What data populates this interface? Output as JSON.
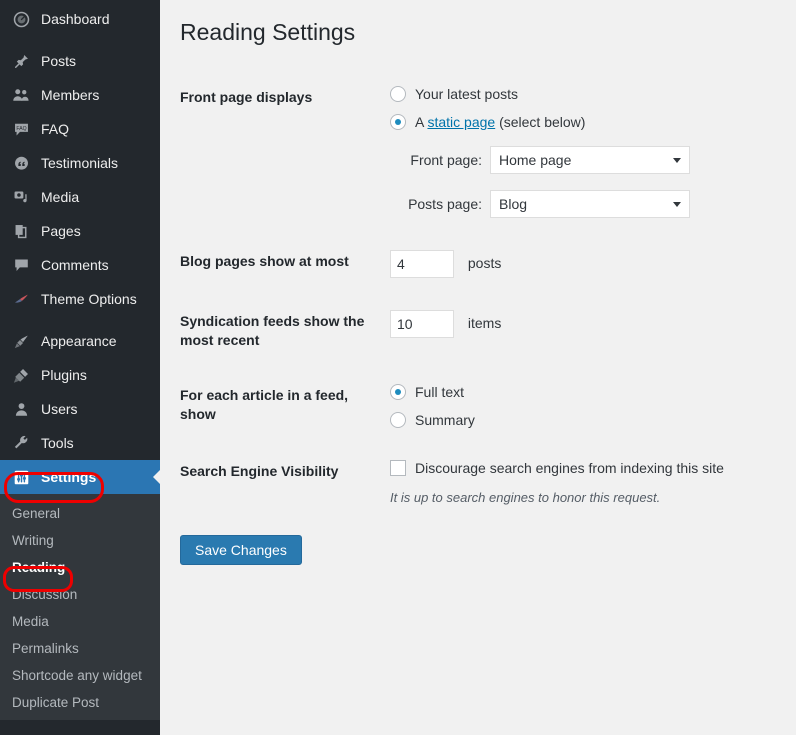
{
  "sidebar": {
    "items": [
      {
        "label": "Dashboard",
        "icon": "dashboard-icon",
        "current": false,
        "gap_after": true
      },
      {
        "label": "Posts",
        "icon": "pin-icon",
        "current": false,
        "gap_after": false
      },
      {
        "label": "Members",
        "icon": "users-group-icon",
        "current": false,
        "gap_after": false
      },
      {
        "label": "FAQ",
        "icon": "faq-bubble-icon",
        "current": false,
        "gap_after": false
      },
      {
        "label": "Testimonials",
        "icon": "quote-bubble-icon",
        "current": false,
        "gap_after": false
      },
      {
        "label": "Media",
        "icon": "media-camera-icon",
        "current": false,
        "gap_after": false
      },
      {
        "label": "Pages",
        "icon": "pages-icon",
        "current": false,
        "gap_after": false
      },
      {
        "label": "Comments",
        "icon": "comment-bubble-icon",
        "current": false,
        "gap_after": false
      },
      {
        "label": "Theme Options",
        "icon": "brush-icon",
        "current": false,
        "gap_after": true
      },
      {
        "label": "Appearance",
        "icon": "paintbrush-icon",
        "current": false,
        "gap_after": false
      },
      {
        "label": "Plugins",
        "icon": "plug-icon",
        "current": false,
        "gap_after": false
      },
      {
        "label": "Users",
        "icon": "user-icon",
        "current": false,
        "gap_after": false
      },
      {
        "label": "Tools",
        "icon": "wrench-icon",
        "current": false,
        "gap_after": false
      },
      {
        "label": "Settings",
        "icon": "settings-sliders-icon",
        "current": true,
        "gap_after": false
      }
    ],
    "submenu": [
      {
        "label": "General",
        "current": false
      },
      {
        "label": "Writing",
        "current": false
      },
      {
        "label": "Reading",
        "current": true
      },
      {
        "label": "Discussion",
        "current": false
      },
      {
        "label": "Media",
        "current": false
      },
      {
        "label": "Permalinks",
        "current": false
      },
      {
        "label": "Shortcode any widget",
        "current": false
      },
      {
        "label": "Duplicate Post",
        "current": false
      }
    ],
    "colors": {
      "background": "#23282d",
      "submenu_background": "#32373c",
      "current_background": "#2b76b3",
      "annotation": "#ee0000"
    }
  },
  "page": {
    "title": "Reading Settings"
  },
  "front_page_displays": {
    "label": "Front page displays",
    "option_latest": "Your latest posts",
    "option_static_prefix": "A ",
    "option_static_link": "static page",
    "option_static_suffix": " (select below)",
    "selected": "static",
    "front_page_label": "Front page:",
    "front_page_value": "Home page",
    "posts_page_label": "Posts page:",
    "posts_page_value": "Blog"
  },
  "blog_pages": {
    "label": "Blog pages show at most",
    "value": "4",
    "unit": "posts"
  },
  "syndication": {
    "label": "Syndication feeds show the most recent",
    "value": "10",
    "unit": "items"
  },
  "feed_article": {
    "label": "For each article in a feed, show",
    "option_full": "Full text",
    "option_summary": "Summary",
    "selected": "full"
  },
  "search_engine_visibility": {
    "label": "Search Engine Visibility",
    "checkbox_label": "Discourage search engines from indexing this site",
    "checked": false,
    "hint": "It is up to search engines to honor this request."
  },
  "actions": {
    "save_label": "Save Changes",
    "save_color": "#2a7ab0"
  }
}
